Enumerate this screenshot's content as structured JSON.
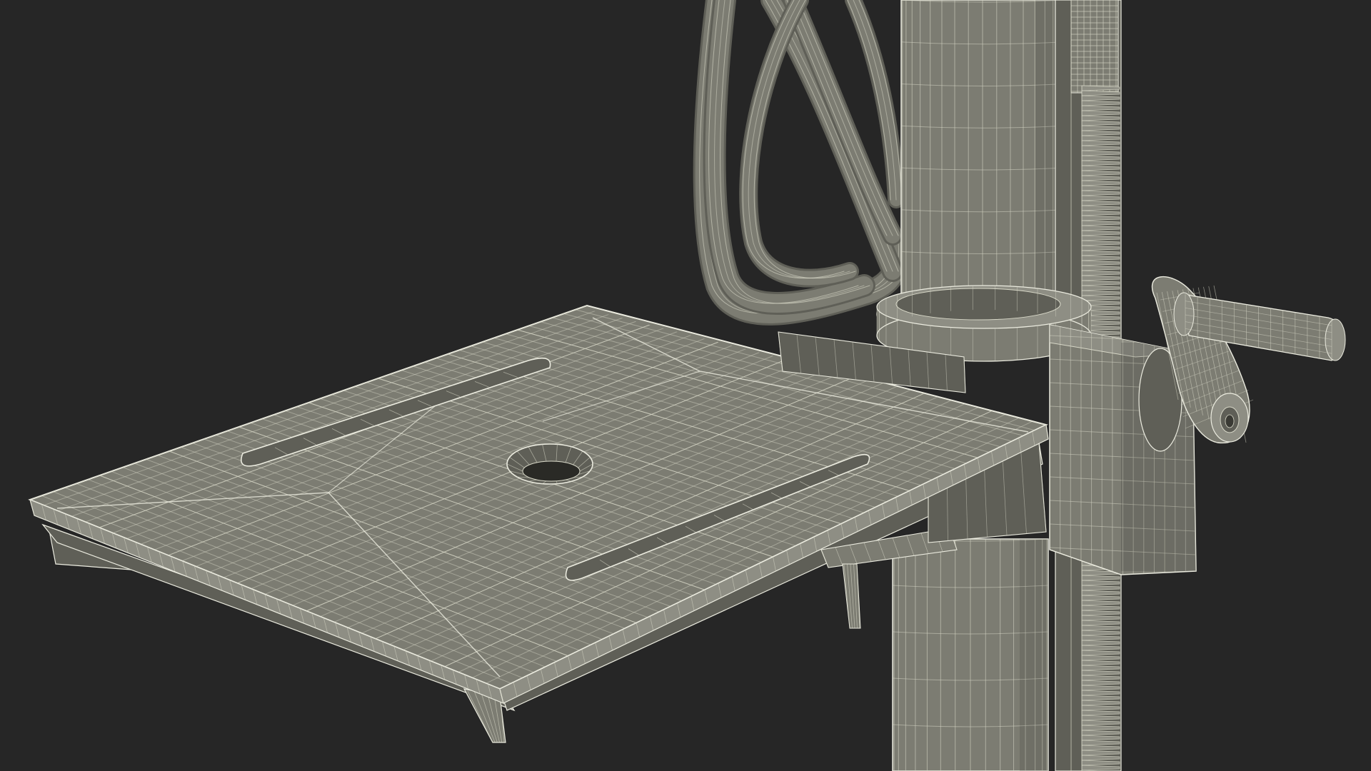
{
  "scene": {
    "subject": "drill-press-wireframe",
    "colors": {
      "background": "#262626",
      "surface": "#7c7c72",
      "surface_dark": "#5f5f57",
      "surface_light": "#8e8e84",
      "wire": "#d8d8c8",
      "outline": "#ecece0"
    },
    "icons": [
      "work-table",
      "column",
      "cable-loop",
      "rack-gear",
      "table-clamp",
      "crank-handle",
      "support-brace"
    ]
  }
}
